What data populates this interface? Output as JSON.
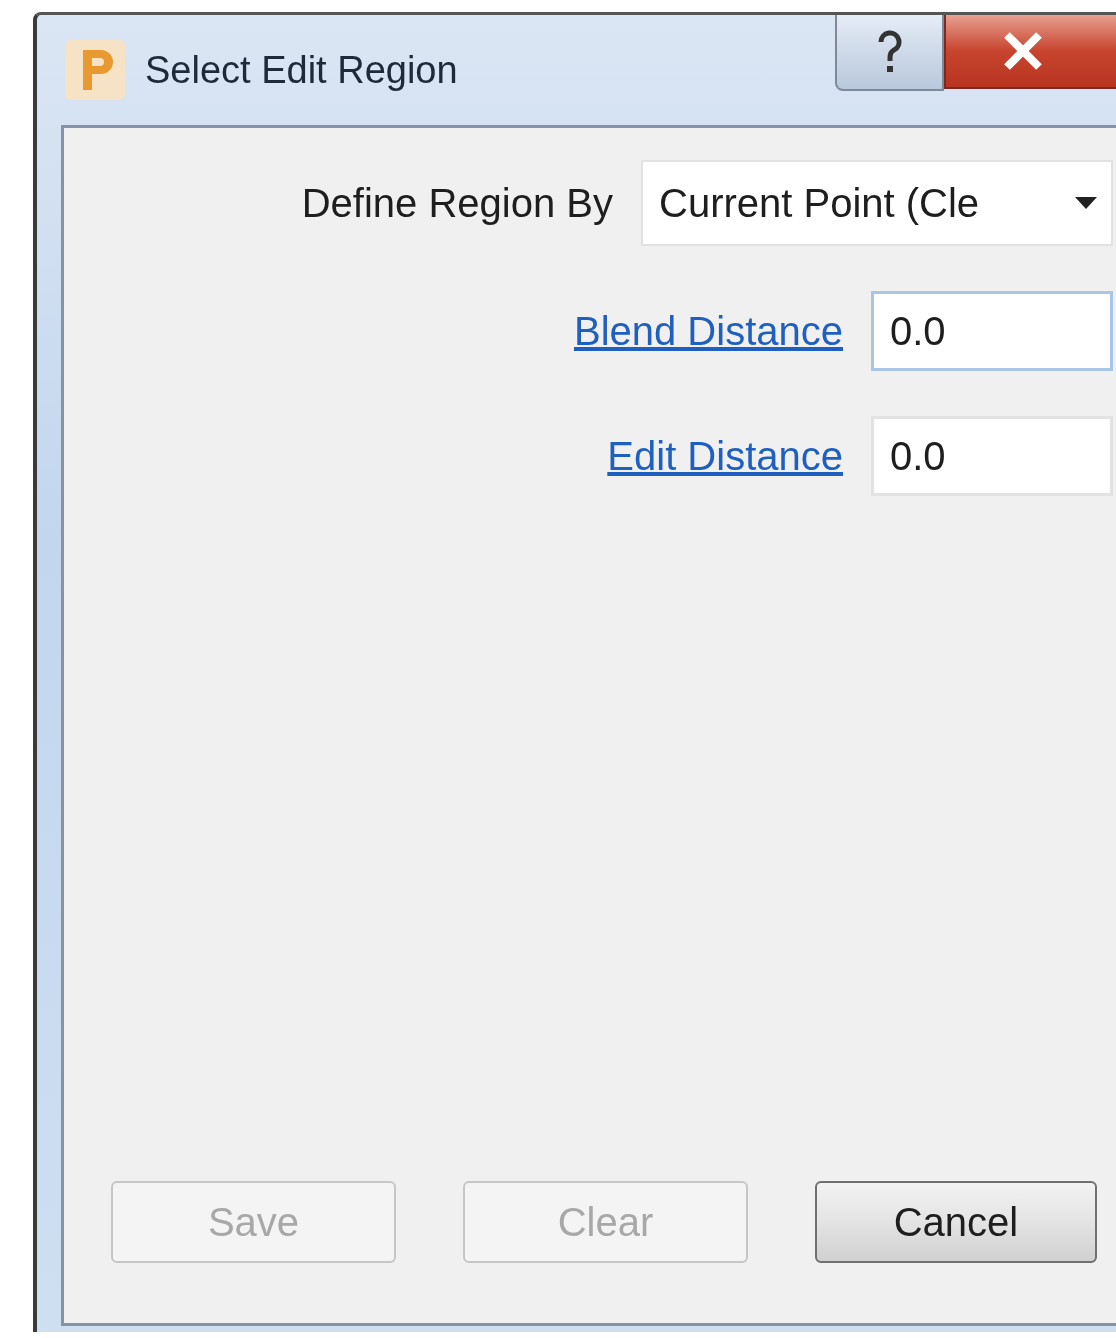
{
  "window": {
    "title": "Select Edit Region"
  },
  "form": {
    "define_region_by": {
      "label": "Define Region By",
      "value": "Current Point (Cle"
    },
    "fields": [
      {
        "label": "Blend Distance",
        "value": "0.0",
        "focused": true
      },
      {
        "label": "Edit Distance",
        "value": "0.0",
        "focused": false
      }
    ]
  },
  "buttons": [
    {
      "label": "Save",
      "disabled": true
    },
    {
      "label": "Clear",
      "disabled": true
    },
    {
      "label": "Cancel",
      "disabled": false
    }
  ]
}
